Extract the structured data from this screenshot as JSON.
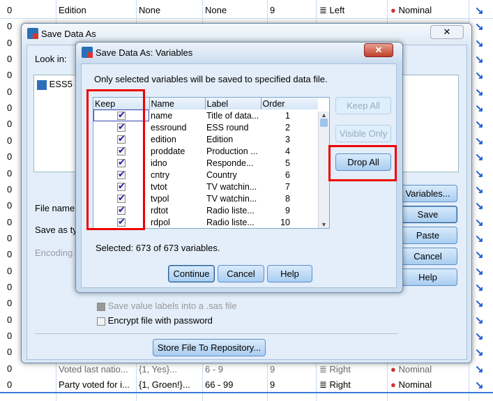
{
  "background_grid": {
    "top_row": {
      "value": "0",
      "name": "Edition",
      "values": "None",
      "missing": "None",
      "columns": "9",
      "align": "Left",
      "measure": "Nominal"
    },
    "bottom_row": {
      "value": "0",
      "name": "Party voted for i...",
      "values": "{1, Groen!}...",
      "missing": "66 - 99",
      "columns": "9",
      "align": "Right",
      "measure": "Nominal"
    },
    "partial_row": {
      "name": "Voted last natio...",
      "values": "{1, Yes}...",
      "missing": "6 - 9",
      "columns": "9",
      "align": "Right",
      "measure": "Nominal"
    },
    "left_values": "0"
  },
  "outer_dialog": {
    "title": "Save Data As",
    "look_in_label": "Look in:",
    "file_item": "ESS5",
    "file_name_label": "File name",
    "save_as_type_label": "Save as ty",
    "encoding_label": "Encoding",
    "buttons": {
      "variables": "Variables...",
      "save": "Save",
      "paste": "Paste",
      "cancel": "Cancel",
      "help": "Help"
    },
    "save_value_labels": "Save value labels into a .sas file",
    "encrypt": "Encrypt file with password",
    "store_repo": "Store File To Repository..."
  },
  "variables_dialog": {
    "title": "Save Data As: Variables",
    "instruction": "Only selected variables will be saved to specified data file.",
    "columns": [
      "Keep",
      "Name",
      "Label",
      "Order"
    ],
    "rows": [
      {
        "keep": true,
        "name": "name",
        "label": "Title of data...",
        "order": "1"
      },
      {
        "keep": true,
        "name": "essround",
        "label": "ESS round",
        "order": "2"
      },
      {
        "keep": true,
        "name": "edition",
        "label": "Edition",
        "order": "3"
      },
      {
        "keep": true,
        "name": "proddate",
        "label": "Production ...",
        "order": "4"
      },
      {
        "keep": true,
        "name": "idno",
        "label": "Responde...",
        "order": "5"
      },
      {
        "keep": true,
        "name": "cntry",
        "label": "Country",
        "order": "6"
      },
      {
        "keep": true,
        "name": "tvtot",
        "label": "TV watchin...",
        "order": "7"
      },
      {
        "keep": true,
        "name": "tvpol",
        "label": "TV watchin...",
        "order": "8"
      },
      {
        "keep": true,
        "name": "rdtot",
        "label": "Radio liste...",
        "order": "9"
      },
      {
        "keep": true,
        "name": "rdpol",
        "label": "Radio liste...",
        "order": "10"
      }
    ],
    "side_buttons": {
      "keep_all": "Keep All",
      "visible_only": "Visible Only",
      "drop_all": "Drop All"
    },
    "status": "Selected: 673 of 673 variables.",
    "buttons": {
      "continue": "Continue",
      "cancel": "Cancel",
      "help": "Help"
    },
    "highlight_color": "#ee0000"
  }
}
